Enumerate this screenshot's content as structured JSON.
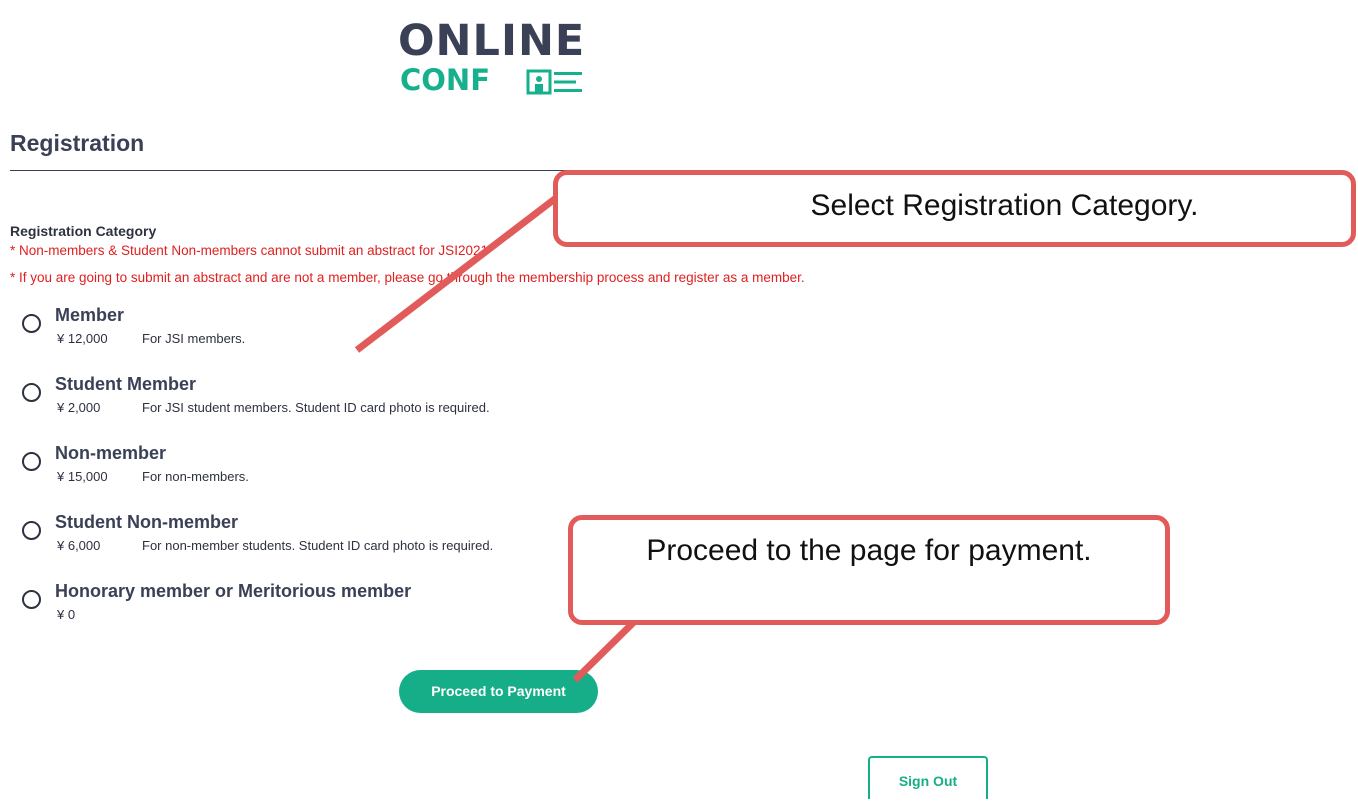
{
  "logo": {
    "top_text": "ONLINE",
    "bottom_text": "CONF"
  },
  "page": {
    "title": "Registration"
  },
  "registration": {
    "category_label": "Registration Category",
    "notes": [
      "* Non-members & Student Non-members cannot submit an abstract for JSI2021",
      "* If you are going to submit an abstract and are not a member, please go through the membership process and register as a member."
    ],
    "options": [
      {
        "name": "Member",
        "price": "¥ 12,000",
        "desc": "For JSI members."
      },
      {
        "name": "Student Member",
        "price": "¥ 2,000",
        "desc": "For JSI student members. Student ID card photo is required."
      },
      {
        "name": "Non-member",
        "price": "¥ 15,000",
        "desc": "For non-members."
      },
      {
        "name": "Student Non-member",
        "price": "¥ 6,000",
        "desc": "For non-member students. Student ID card photo is required."
      },
      {
        "name": "Honorary member or Meritorious member",
        "price": "¥ 0",
        "desc": ""
      }
    ]
  },
  "buttons": {
    "proceed": "Proceed to Payment",
    "signout": "Sign Out"
  },
  "callouts": {
    "select": "Select Registration Category.",
    "proceed": "Proceed to the page for payment."
  },
  "colors": {
    "accent": "#16ae88",
    "note": "#e02020",
    "callout_border": "#e25b5b",
    "heading": "#3a4156"
  }
}
